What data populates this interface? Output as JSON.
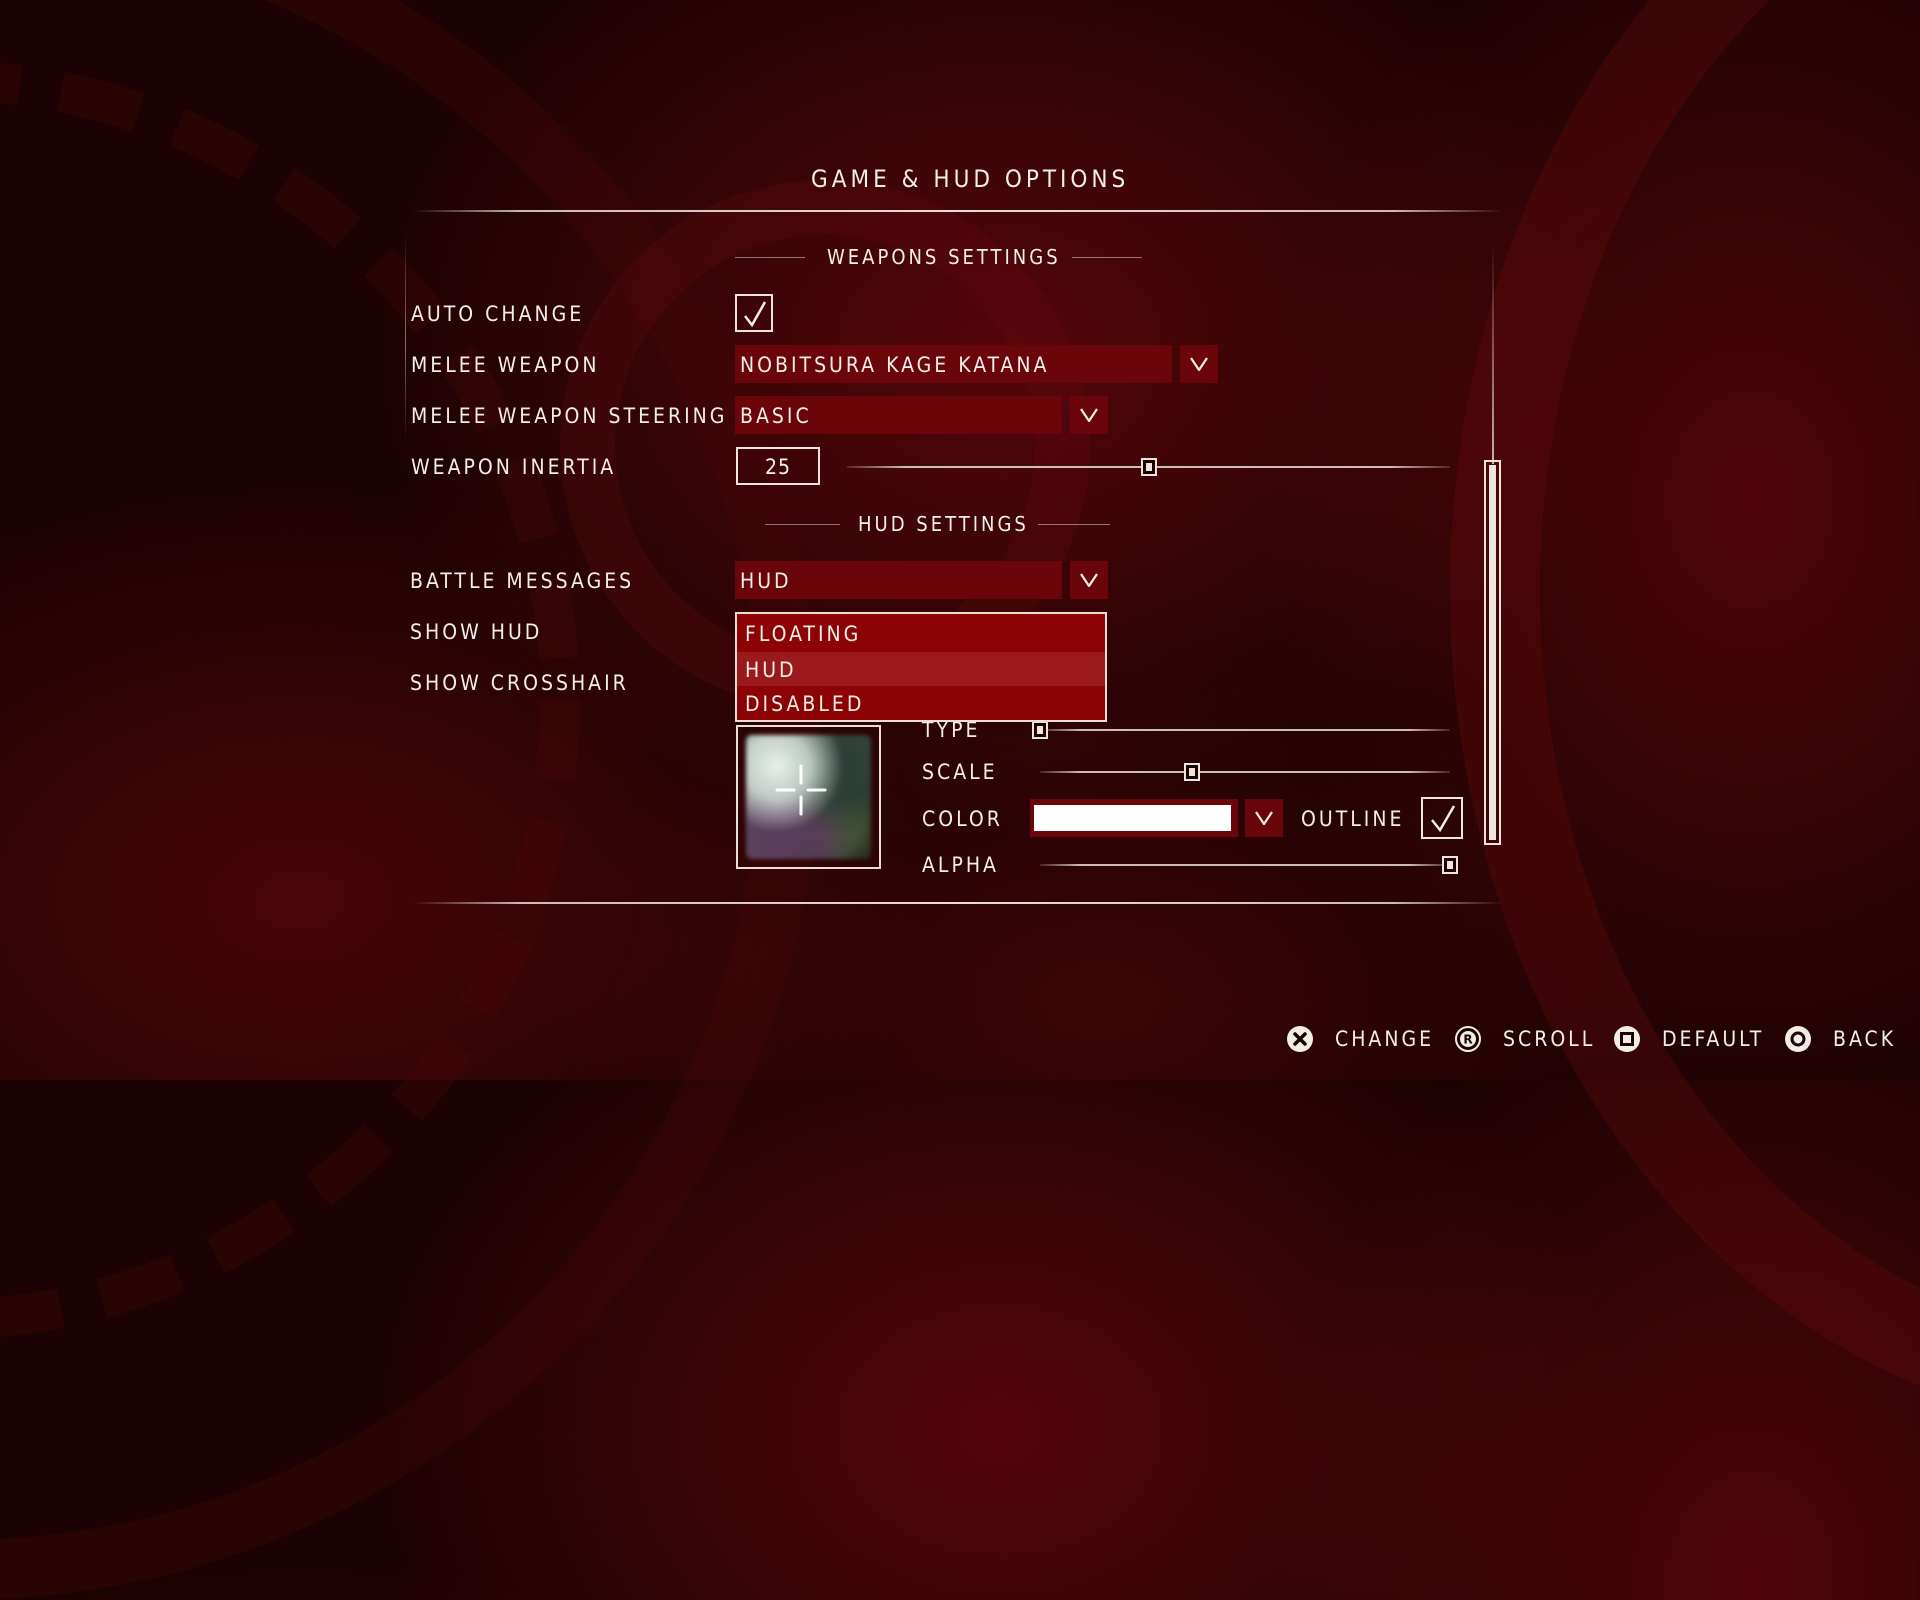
{
  "screen": {
    "title": "GAME & HUD OPTIONS"
  },
  "weapons_section": {
    "header": "WEAPONS SETTINGS",
    "auto_change": {
      "label": "AUTO CHANGE",
      "checked": true
    },
    "melee_weapon": {
      "label": "MELEE WEAPON",
      "value": "NOBITSURA KAGE KATANA"
    },
    "melee_weapon_steering": {
      "label": "MELEE WEAPON STEERING",
      "value": "BASIC"
    },
    "weapon_inertia": {
      "label": "WEAPON INERTIA",
      "value": "25",
      "slider_fraction": 0.5
    }
  },
  "hud_section": {
    "header": "HUD SETTINGS",
    "battle_messages": {
      "label": "BATTLE MESSAGES",
      "value": "HUD",
      "dropdown_open": true,
      "options": [
        "FLOATING",
        "HUD",
        "DISABLED"
      ],
      "highlighted_option": "HUD"
    },
    "show_hud": {
      "label": "SHOW HUD"
    },
    "show_crosshair": {
      "label": "SHOW CROSSHAIR"
    },
    "crosshair": {
      "type": {
        "label": "TYPE",
        "slider_fraction": 0.0
      },
      "scale": {
        "label": "SCALE",
        "slider_fraction": 0.37
      },
      "color": {
        "label": "COLOR",
        "value_hex": "#ffffff"
      },
      "outline": {
        "label": "OUTLINE",
        "checked": true
      },
      "alpha": {
        "label": "ALPHA",
        "slider_fraction": 1.0
      }
    }
  },
  "scrollbar": {
    "position_fraction": 0.3,
    "visible_fraction": 0.64
  },
  "footer": {
    "actions": [
      {
        "button": "cross",
        "label": "CHANGE"
      },
      {
        "button": "R",
        "label": "SCROLL"
      },
      {
        "button": "square",
        "label": "DEFAULT"
      },
      {
        "button": "circle",
        "label": "BACK"
      }
    ]
  },
  "colors": {
    "field_red": "#6a0609",
    "list_red": "#8c0205",
    "list_highlight": "#9a1a1c",
    "text": "#f3eee6",
    "background": "#1c0204"
  }
}
